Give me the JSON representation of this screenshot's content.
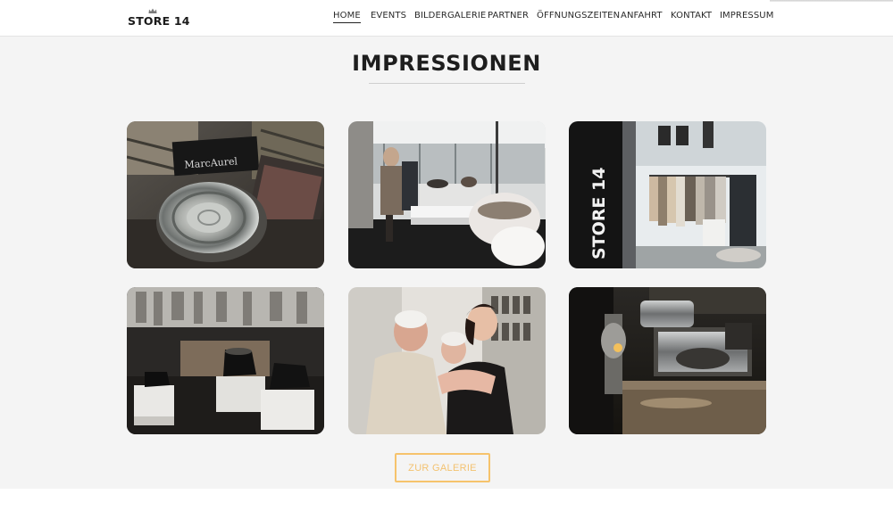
{
  "brand": {
    "name": "STORE 14",
    "crown_icon": "crown-icon"
  },
  "nav": {
    "items": [
      {
        "label": "HOME",
        "active": true
      },
      {
        "label": "EVENTS",
        "active": false
      },
      {
        "label": "BILDERGALERIE",
        "active": false
      },
      {
        "label": "PARTNER",
        "active": false
      },
      {
        "label": "ÖFFNUNGSZEITEN",
        "active": false
      },
      {
        "label": "ANFAHRT",
        "active": false
      },
      {
        "label": "KONTAKT",
        "active": false
      },
      {
        "label": "IMPRESSUM",
        "active": false
      }
    ]
  },
  "impressions": {
    "title": "IMPRESSIONEN",
    "photos": [
      {
        "subject": "silver plates and Marc Aurel display"
      },
      {
        "subject": "boutique interior with mannequin"
      },
      {
        "subject": "clothing rack with Store 14 sign"
      },
      {
        "subject": "shoes displayed on white crates"
      },
      {
        "subject": "guests embracing at event"
      },
      {
        "subject": "espresso machine on counter"
      }
    ],
    "gallery_button": "ZUR GALERIE"
  },
  "colors": {
    "accent": "#f6c36c",
    "section_bg": "#f4f4f4",
    "text": "#222222"
  }
}
